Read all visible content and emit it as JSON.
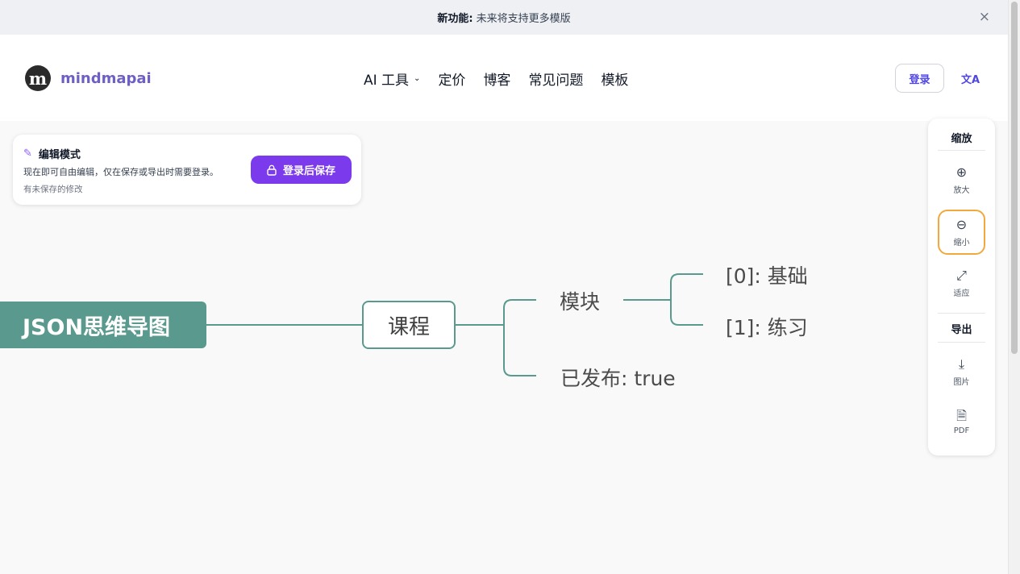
{
  "announcement": {
    "label": "新功能:",
    "text": "未来将支持更多模版",
    "close": "×"
  },
  "brand": {
    "logo_letter": "m",
    "name": "mindmapai"
  },
  "nav": {
    "items": [
      "AI 工具",
      "定价",
      "博客",
      "常见问题",
      "模板"
    ],
    "dropdown_chevron": "⌄"
  },
  "header": {
    "login": "登录",
    "lang_icon": "文A"
  },
  "edit_notice": {
    "title": "编辑模式",
    "description": "现在即可自由编辑，仅在保存或导出时需要登录。",
    "status": "有未保存的修改",
    "save_button": "登录后保存",
    "pen_icon": "✎",
    "lock_icon": "🔒"
  },
  "mindmap": {
    "root": "JSON思维导图",
    "course": "课程",
    "module": "模块",
    "item0": "[0]: 基础",
    "item1": "[1]: 练习",
    "published": "已发布: true",
    "line_color": "#5a9a8e"
  },
  "side_panel": {
    "zoom_heading": "缩放",
    "zoom_in": {
      "icon": "⊕",
      "label": "放大"
    },
    "zoom_out": {
      "icon": "⊖",
      "label": "缩小"
    },
    "fit": {
      "icon": "⤢",
      "label": "适应"
    },
    "export_heading": "导出",
    "image": {
      "icon": "⤓",
      "label": "图片"
    },
    "pdf": {
      "icon": "🗎",
      "label": "PDF"
    }
  },
  "colors": {
    "accent": "#7c3aed",
    "brand_text": "#6d5fc5",
    "node": "#5a9a8e",
    "highlight": "#f2a93b"
  }
}
